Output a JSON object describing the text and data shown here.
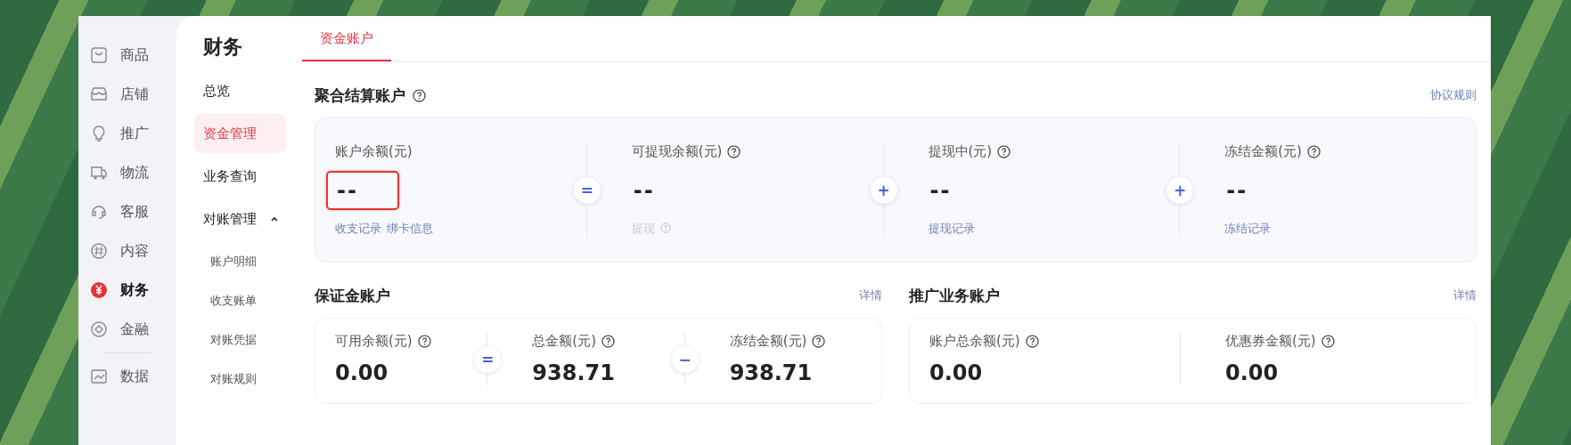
{
  "sidebar": {
    "items": [
      {
        "label": "商品",
        "selected": false
      },
      {
        "label": "店铺",
        "selected": false
      },
      {
        "label": "推广",
        "selected": false
      },
      {
        "label": "物流",
        "selected": false
      },
      {
        "label": "客服",
        "selected": false
      },
      {
        "label": "内容",
        "selected": false
      },
      {
        "label": "财务",
        "selected": true
      },
      {
        "label": "金融",
        "selected": false
      },
      {
        "label": "数据",
        "selected": false
      }
    ]
  },
  "nav": {
    "title": "财务",
    "items": [
      {
        "label": "总览",
        "selected": false
      },
      {
        "label": "资金管理",
        "selected": true
      },
      {
        "label": "业务查询",
        "selected": false
      },
      {
        "label": "对账管理",
        "selected": false,
        "expanded": true,
        "children": [
          {
            "label": "账户明细",
            "selected": false
          },
          {
            "label": "收支账单",
            "selected": false
          },
          {
            "label": "对账凭据",
            "selected": false
          },
          {
            "label": "对账规则",
            "selected": false
          }
        ]
      }
    ]
  },
  "tabs": [
    {
      "label": "资金账户",
      "selected": true
    }
  ],
  "settlement": {
    "title": "聚合结算账户",
    "link": "协议规则",
    "metrics": [
      {
        "label": "账户余额(元)",
        "help": false,
        "value": "--",
        "highlighted": true,
        "links": [
          {
            "text": "收支记录",
            "disabled": false,
            "help": false
          },
          {
            "text": "绑卡信息",
            "disabled": false,
            "help": false
          }
        ]
      },
      {
        "operator": "=",
        "label": "可提现余额(元)",
        "help": true,
        "value": "--",
        "highlighted": false,
        "links": [
          {
            "text": "提现",
            "disabled": true,
            "help": true
          }
        ]
      },
      {
        "operator": "+",
        "label": "提现中(元)",
        "help": true,
        "value": "--",
        "highlighted": false,
        "links": [
          {
            "text": "提现记录",
            "disabled": false,
            "help": false
          }
        ]
      },
      {
        "operator": "+",
        "label": "冻结金额(元)",
        "help": true,
        "value": "--",
        "highlighted": false,
        "links": [
          {
            "text": "冻结记录",
            "disabled": false,
            "help": false
          }
        ]
      }
    ]
  },
  "accounts": [
    {
      "title": "保证金账户",
      "link": "详情",
      "metrics": [
        {
          "label": "可用余额(元)",
          "help": true,
          "value": "0.00"
        },
        {
          "operator": "=",
          "label": "总金额(元)",
          "help": true,
          "value": "938.71"
        },
        {
          "operator": "−",
          "label": "冻结金额(元)",
          "help": true,
          "value": "938.71"
        }
      ]
    },
    {
      "title": "推广业务账户",
      "link": "详情",
      "metrics": [
        {
          "label": "账户总余额(元)",
          "help": true,
          "value": "0.00"
        },
        {
          "label": "优惠券金额(元)",
          "help": true,
          "value": "0.00"
        }
      ]
    }
  ]
}
